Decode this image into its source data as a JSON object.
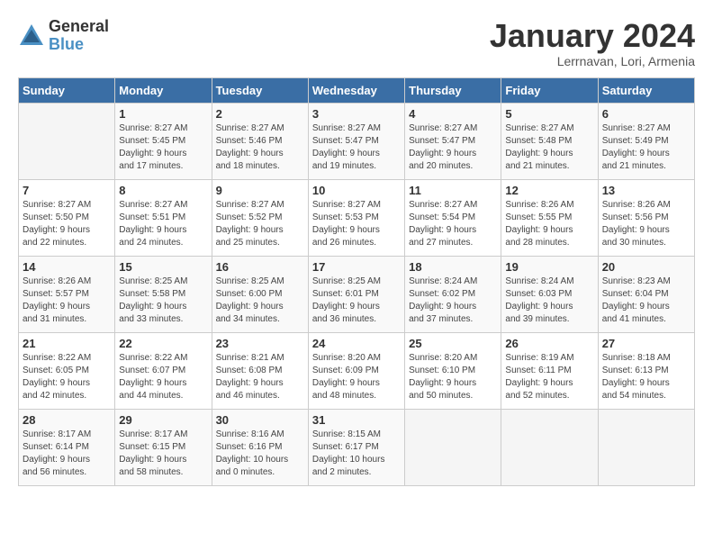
{
  "logo": {
    "general": "General",
    "blue": "Blue"
  },
  "title": "January 2024",
  "subtitle": "Lerrnavan, Lori, Armenia",
  "days_of_week": [
    "Sunday",
    "Monday",
    "Tuesday",
    "Wednesday",
    "Thursday",
    "Friday",
    "Saturday"
  ],
  "weeks": [
    [
      {
        "day": "",
        "info": ""
      },
      {
        "day": "1",
        "info": "Sunrise: 8:27 AM\nSunset: 5:45 PM\nDaylight: 9 hours\nand 17 minutes."
      },
      {
        "day": "2",
        "info": "Sunrise: 8:27 AM\nSunset: 5:46 PM\nDaylight: 9 hours\nand 18 minutes."
      },
      {
        "day": "3",
        "info": "Sunrise: 8:27 AM\nSunset: 5:47 PM\nDaylight: 9 hours\nand 19 minutes."
      },
      {
        "day": "4",
        "info": "Sunrise: 8:27 AM\nSunset: 5:47 PM\nDaylight: 9 hours\nand 20 minutes."
      },
      {
        "day": "5",
        "info": "Sunrise: 8:27 AM\nSunset: 5:48 PM\nDaylight: 9 hours\nand 21 minutes."
      },
      {
        "day": "6",
        "info": "Sunrise: 8:27 AM\nSunset: 5:49 PM\nDaylight: 9 hours\nand 21 minutes."
      }
    ],
    [
      {
        "day": "7",
        "info": "Sunrise: 8:27 AM\nSunset: 5:50 PM\nDaylight: 9 hours\nand 22 minutes."
      },
      {
        "day": "8",
        "info": "Sunrise: 8:27 AM\nSunset: 5:51 PM\nDaylight: 9 hours\nand 24 minutes."
      },
      {
        "day": "9",
        "info": "Sunrise: 8:27 AM\nSunset: 5:52 PM\nDaylight: 9 hours\nand 25 minutes."
      },
      {
        "day": "10",
        "info": "Sunrise: 8:27 AM\nSunset: 5:53 PM\nDaylight: 9 hours\nand 26 minutes."
      },
      {
        "day": "11",
        "info": "Sunrise: 8:27 AM\nSunset: 5:54 PM\nDaylight: 9 hours\nand 27 minutes."
      },
      {
        "day": "12",
        "info": "Sunrise: 8:26 AM\nSunset: 5:55 PM\nDaylight: 9 hours\nand 28 minutes."
      },
      {
        "day": "13",
        "info": "Sunrise: 8:26 AM\nSunset: 5:56 PM\nDaylight: 9 hours\nand 30 minutes."
      }
    ],
    [
      {
        "day": "14",
        "info": "Sunrise: 8:26 AM\nSunset: 5:57 PM\nDaylight: 9 hours\nand 31 minutes."
      },
      {
        "day": "15",
        "info": "Sunrise: 8:25 AM\nSunset: 5:58 PM\nDaylight: 9 hours\nand 33 minutes."
      },
      {
        "day": "16",
        "info": "Sunrise: 8:25 AM\nSunset: 6:00 PM\nDaylight: 9 hours\nand 34 minutes."
      },
      {
        "day": "17",
        "info": "Sunrise: 8:25 AM\nSunset: 6:01 PM\nDaylight: 9 hours\nand 36 minutes."
      },
      {
        "day": "18",
        "info": "Sunrise: 8:24 AM\nSunset: 6:02 PM\nDaylight: 9 hours\nand 37 minutes."
      },
      {
        "day": "19",
        "info": "Sunrise: 8:24 AM\nSunset: 6:03 PM\nDaylight: 9 hours\nand 39 minutes."
      },
      {
        "day": "20",
        "info": "Sunrise: 8:23 AM\nSunset: 6:04 PM\nDaylight: 9 hours\nand 41 minutes."
      }
    ],
    [
      {
        "day": "21",
        "info": "Sunrise: 8:22 AM\nSunset: 6:05 PM\nDaylight: 9 hours\nand 42 minutes."
      },
      {
        "day": "22",
        "info": "Sunrise: 8:22 AM\nSunset: 6:07 PM\nDaylight: 9 hours\nand 44 minutes."
      },
      {
        "day": "23",
        "info": "Sunrise: 8:21 AM\nSunset: 6:08 PM\nDaylight: 9 hours\nand 46 minutes."
      },
      {
        "day": "24",
        "info": "Sunrise: 8:20 AM\nSunset: 6:09 PM\nDaylight: 9 hours\nand 48 minutes."
      },
      {
        "day": "25",
        "info": "Sunrise: 8:20 AM\nSunset: 6:10 PM\nDaylight: 9 hours\nand 50 minutes."
      },
      {
        "day": "26",
        "info": "Sunrise: 8:19 AM\nSunset: 6:11 PM\nDaylight: 9 hours\nand 52 minutes."
      },
      {
        "day": "27",
        "info": "Sunrise: 8:18 AM\nSunset: 6:13 PM\nDaylight: 9 hours\nand 54 minutes."
      }
    ],
    [
      {
        "day": "28",
        "info": "Sunrise: 8:17 AM\nSunset: 6:14 PM\nDaylight: 9 hours\nand 56 minutes."
      },
      {
        "day": "29",
        "info": "Sunrise: 8:17 AM\nSunset: 6:15 PM\nDaylight: 9 hours\nand 58 minutes."
      },
      {
        "day": "30",
        "info": "Sunrise: 8:16 AM\nSunset: 6:16 PM\nDaylight: 10 hours\nand 0 minutes."
      },
      {
        "day": "31",
        "info": "Sunrise: 8:15 AM\nSunset: 6:17 PM\nDaylight: 10 hours\nand 2 minutes."
      },
      {
        "day": "",
        "info": ""
      },
      {
        "day": "",
        "info": ""
      },
      {
        "day": "",
        "info": ""
      }
    ]
  ]
}
